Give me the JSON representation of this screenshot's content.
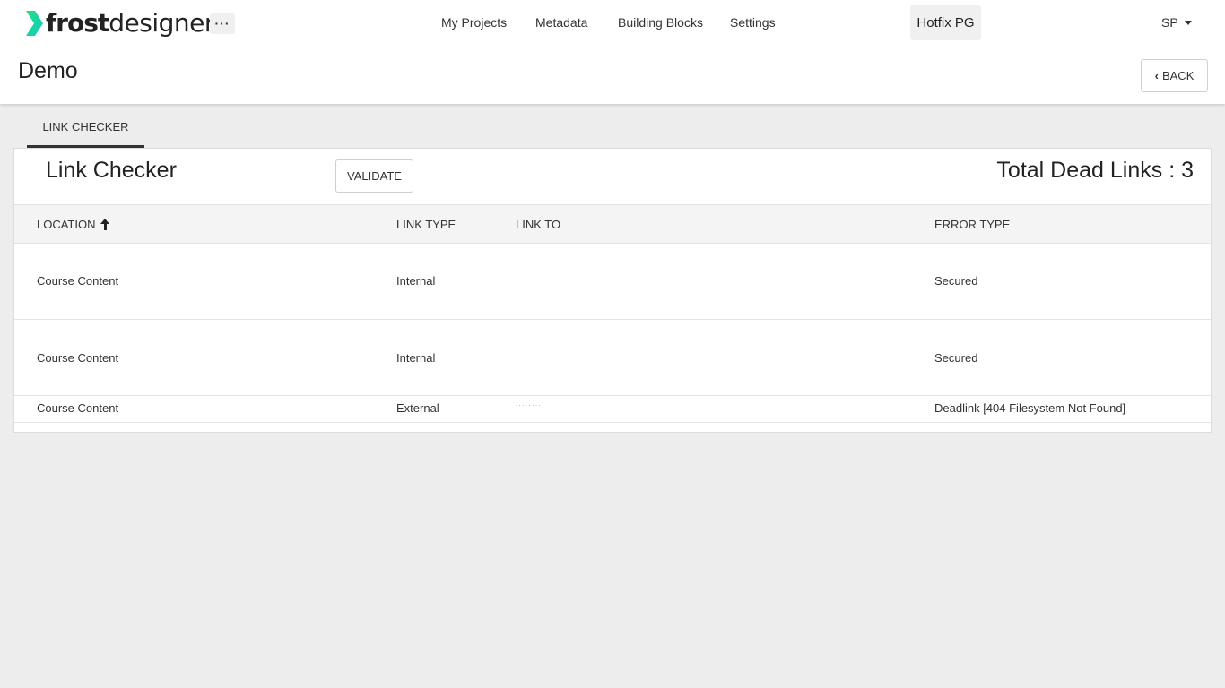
{
  "app": {
    "logo_bold": "frost",
    "logo_light": "designer",
    "more_label": "···",
    "logo_color": "#1fd6a0"
  },
  "nav": {
    "items": [
      "My Projects",
      "Metadata",
      "Building Blocks",
      "Settings"
    ],
    "workspace": "Hotfix PG",
    "user": "SP"
  },
  "header": {
    "title": "Demo",
    "back_label": "BACK"
  },
  "tabs": [
    "LINK CHECKER"
  ],
  "panel": {
    "title": "Link Checker",
    "validate_label": "VALIDATE",
    "total_dead_links": "Total Dead Links : 3"
  },
  "table": {
    "columns": [
      "LOCATION",
      "LINK TYPE",
      "LINK TO",
      "ERROR TYPE"
    ],
    "sort_column": "LOCATION",
    "sort_direction": "ascending",
    "rows": [
      {
        "location": "Course Content",
        "link_type": "Internal",
        "link_to": "",
        "error_type": "Secured"
      },
      {
        "location": "Course Content",
        "link_type": "Internal",
        "link_to": "",
        "error_type": "Secured"
      },
      {
        "location": "Course Content",
        "link_type": "External",
        "link_to": "· · · · · · · · ·",
        "error_type": "Deadlink [404 Filesystem Not Found]"
      }
    ]
  }
}
